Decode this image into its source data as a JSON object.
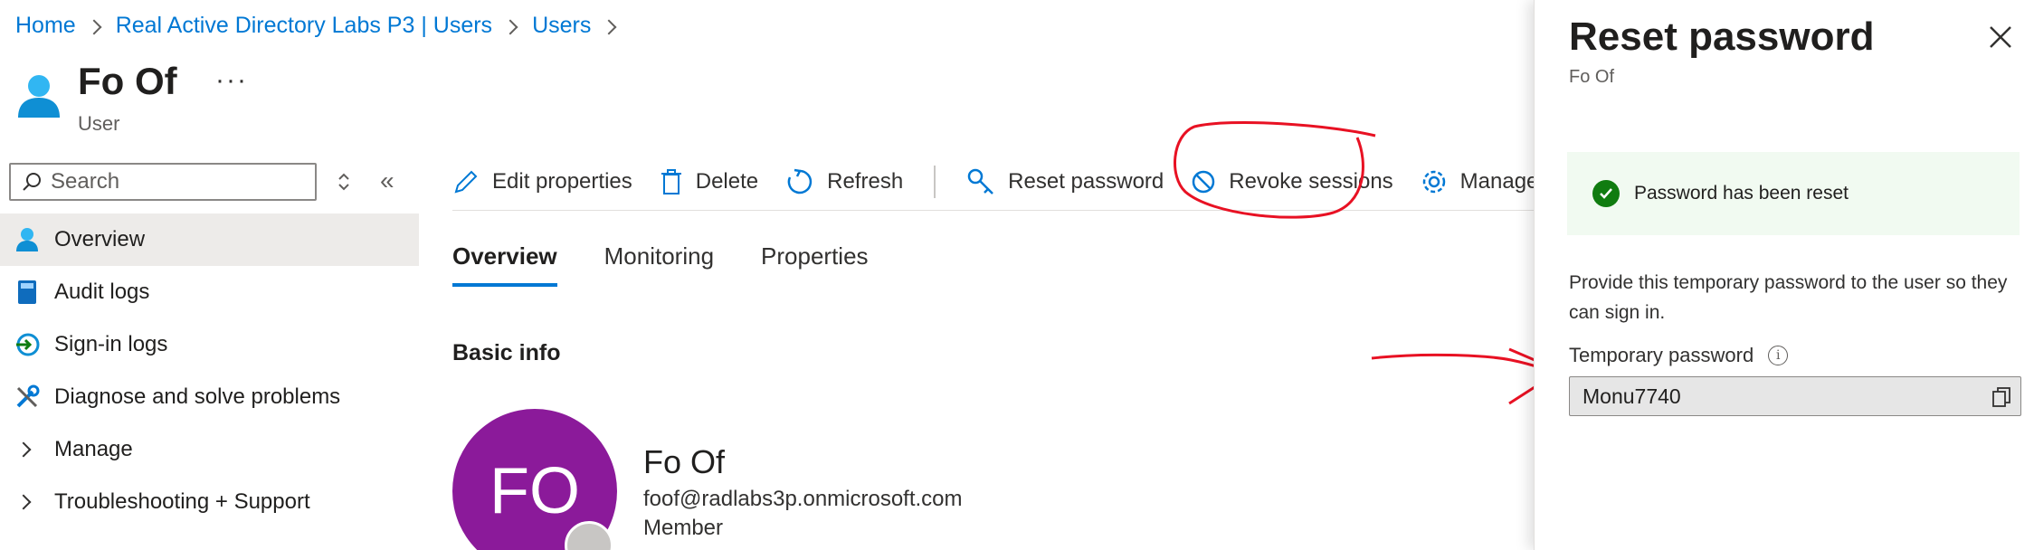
{
  "breadcrumb": [
    "Home",
    "Real Active Directory Labs P3 | Users",
    "Users"
  ],
  "header": {
    "title": "Fo Of",
    "subtitle": "User",
    "more": "···"
  },
  "sidebar": {
    "search_placeholder": "Search",
    "items": [
      {
        "label": "Overview",
        "icon": "user-icon",
        "active": true
      },
      {
        "label": "Audit logs",
        "icon": "book-icon"
      },
      {
        "label": "Sign-in logs",
        "icon": "sign-in-icon"
      },
      {
        "label": "Diagnose and solve problems",
        "icon": "wrench-icon"
      },
      {
        "label": "Manage",
        "icon": "chevron-right-icon"
      },
      {
        "label": "Troubleshooting + Support",
        "icon": "chevron-right-icon"
      }
    ]
  },
  "toolbar": {
    "edit": "Edit properties",
    "delete": "Delete",
    "refresh": "Refresh",
    "reset": "Reset password",
    "revoke": "Revoke sessions",
    "manage": "Manage vi"
  },
  "tabs": [
    "Overview",
    "Monitoring",
    "Properties"
  ],
  "main": {
    "section_title": "Basic info",
    "avatar_initials": "FO",
    "name": "Fo Of",
    "email": "foof@radlabs3p.onmicrosoft.com",
    "user_type": "Member"
  },
  "panel": {
    "title": "Reset password",
    "subtitle": "Fo Of",
    "success_message": "Password has been reset",
    "description": "Provide this temporary password to the user so they can sign in.",
    "password_label": "Temporary password",
    "password_value": "Monu7740"
  },
  "colors": {
    "accent": "#0078d4",
    "avatar": "#8b1a9a",
    "success": "#107c10",
    "annotation": "#e81123"
  }
}
